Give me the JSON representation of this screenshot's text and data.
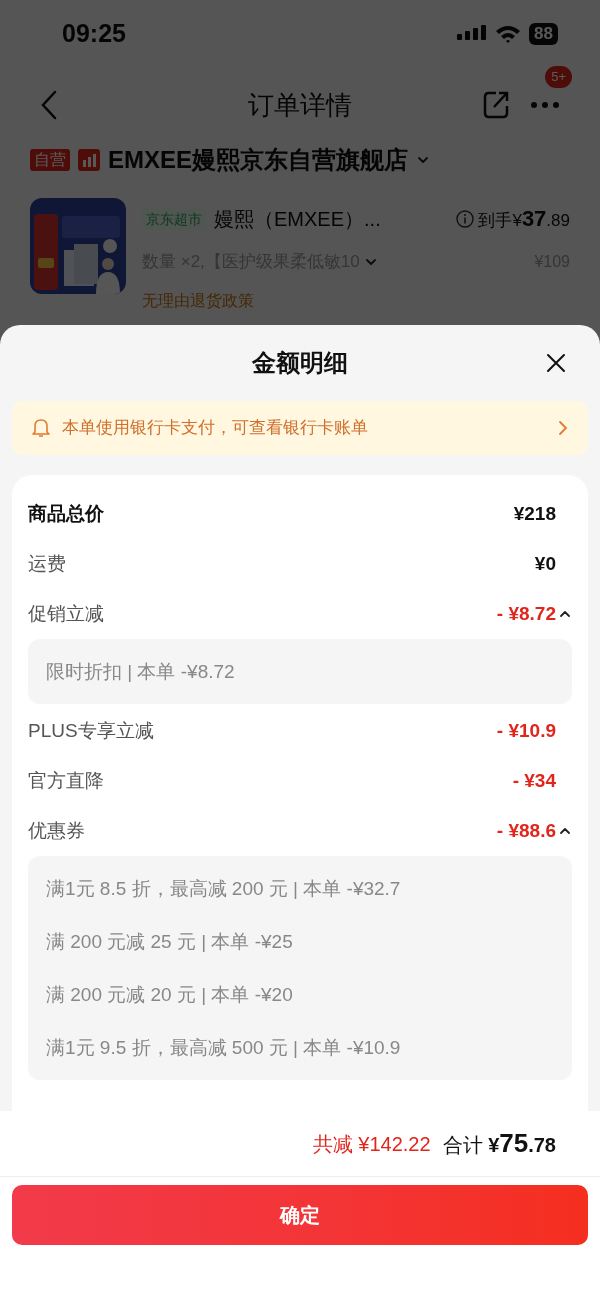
{
  "status_bar": {
    "time": "09:25",
    "battery": "88"
  },
  "nav": {
    "title": "订单详情",
    "badge": "5+"
  },
  "store": {
    "tags": [
      "自营"
    ],
    "name": "EMXEE嫚熙京东自营旗舰店"
  },
  "product": {
    "channel": "京东超市",
    "name": "嫚熙（EMXEE）...",
    "price_label": "到手",
    "price_currency": "¥",
    "price_int": "37",
    "price_dec": ".89",
    "spec": "数量 ×2,【医护级果柔低敏10",
    "original_price": "¥109",
    "policy": "无理由退货政策"
  },
  "sheet": {
    "title": "金额明细",
    "notice": "本单使用银行卡支付，可查看银行卡账单",
    "rows": [
      {
        "kind": "total",
        "label": "商品总价",
        "amount": "¥218"
      },
      {
        "kind": "normal",
        "label": "运费",
        "amount": "¥0"
      },
      {
        "kind": "discount",
        "label": "促销立减",
        "amount": "- ¥8.72",
        "expanded": true,
        "details": [
          "限时折扣 | 本单 -¥8.72"
        ]
      },
      {
        "kind": "discount",
        "label": "PLUS专享立减",
        "amount": "- ¥10.9"
      },
      {
        "kind": "discount",
        "label": "官方直降",
        "amount": "- ¥34"
      },
      {
        "kind": "discount",
        "label": "优惠券",
        "amount": "- ¥88.6",
        "expanded": true,
        "details": [
          "满1元 8.5 折，最高减 200 元 | 本单 -¥32.7",
          "满 200 元减 25 元 | 本单 -¥25",
          "满 200 元减 20 元 | 本单 -¥20",
          "满1元 9.5 折，最高减 500 元 | 本单 -¥10.9"
        ]
      }
    ],
    "saved": "共减 ¥142.22",
    "total_label": "合计",
    "total_currency": "¥",
    "total_int": "75",
    "total_dec": ".78",
    "confirm": "确定"
  }
}
